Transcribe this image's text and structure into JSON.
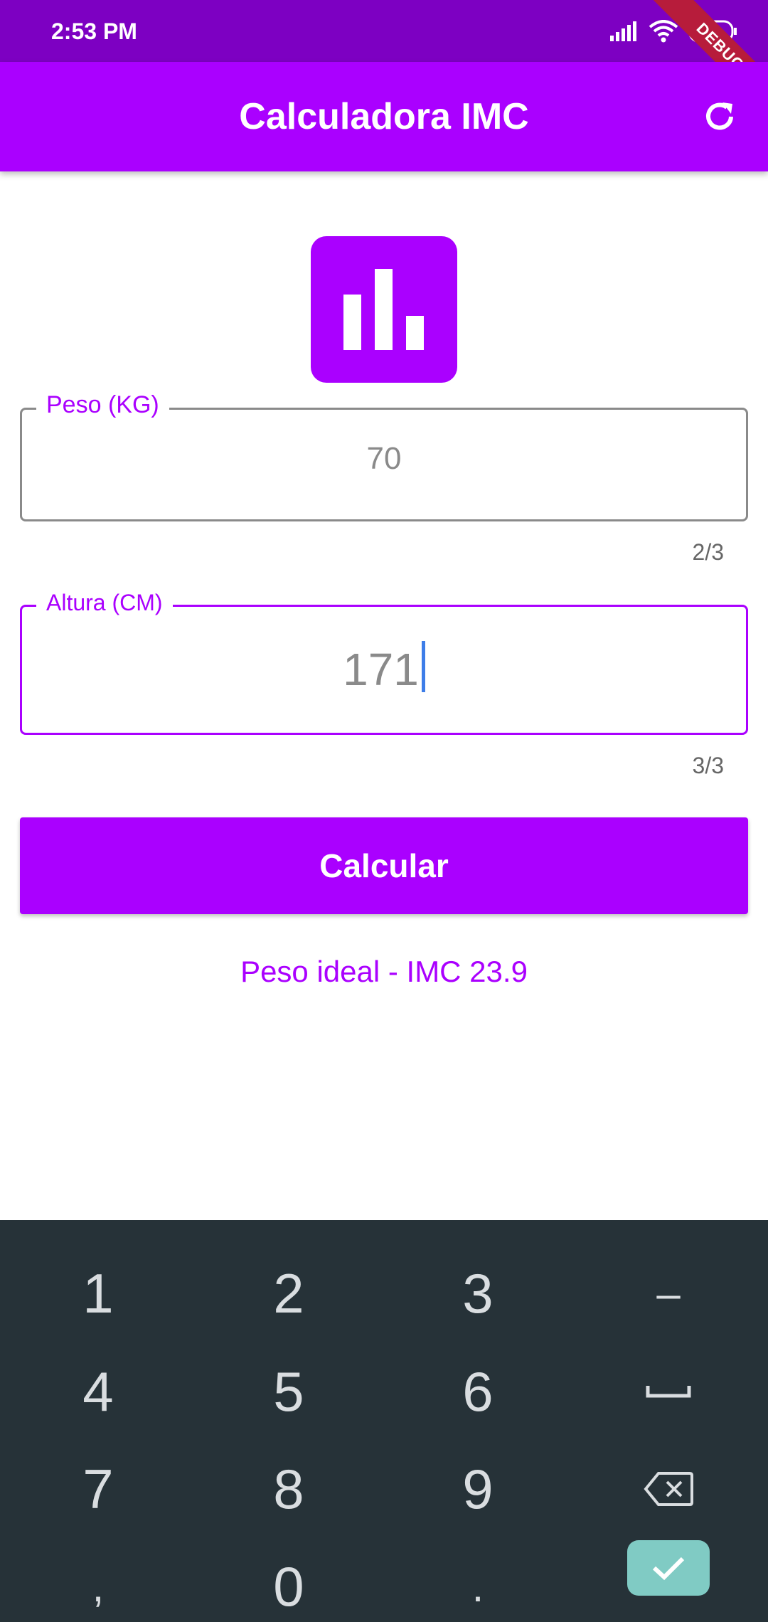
{
  "status_bar": {
    "time": "2:53 PM"
  },
  "debug_banner": "DEBUG",
  "app_bar": {
    "title": "Calculadora IMC"
  },
  "form": {
    "weight": {
      "label": "Peso (KG)",
      "value": "70",
      "counter": "2/3"
    },
    "height": {
      "label": "Altura (CM)",
      "value": "171",
      "counter": "3/3"
    }
  },
  "calculate_label": "Calcular",
  "result_text": "Peso ideal - IMC 23.9",
  "keyboard": {
    "keys": {
      "k1": "1",
      "k2": "2",
      "k3": "3",
      "minus": "–",
      "k4": "4",
      "k5": "5",
      "k6": "6",
      "k7": "7",
      "k8": "8",
      "k9": "9",
      "comma": ",",
      "k0": "0",
      "dot": "."
    }
  },
  "colors": {
    "status_bar": "#7d00c2",
    "accent": "#aa00ff",
    "keyboard_bg": "#263238",
    "done_key": "#80cbc4"
  },
  "icons": {
    "refresh": "refresh-icon",
    "logo": "bar-chart-icon",
    "space": "space-bar-icon",
    "backspace": "backspace-icon",
    "done": "check-icon"
  }
}
